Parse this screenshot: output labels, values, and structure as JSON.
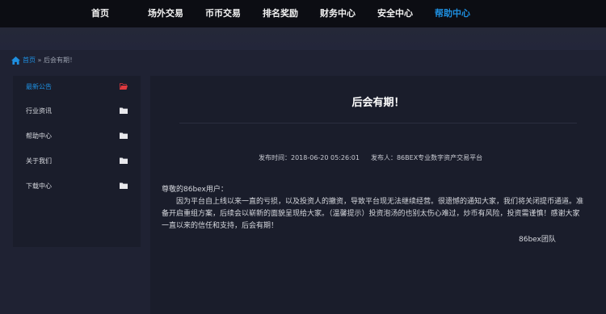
{
  "nav": {
    "items": [
      {
        "label": "首页"
      },
      {
        "label": "场外交易"
      },
      {
        "label": "币币交易"
      },
      {
        "label": "排名奖励"
      },
      {
        "label": "财务中心"
      },
      {
        "label": "安全中心"
      },
      {
        "label": "帮助中心"
      }
    ],
    "active": "帮助中心"
  },
  "breadcrumb": {
    "home": "首页",
    "separator": "»",
    "current": "后会有期！"
  },
  "sidebar": {
    "items": [
      {
        "label": "最新公告",
        "icon": "folder-open-icon"
      },
      {
        "label": "行业资讯",
        "icon": "folder-icon"
      },
      {
        "label": "帮助中心",
        "icon": "folder-icon"
      },
      {
        "label": "关于我们",
        "icon": "folder-icon"
      },
      {
        "label": "下载中心",
        "icon": "folder-icon"
      }
    ],
    "active": "最新公告"
  },
  "article": {
    "title": "后会有期！",
    "publish_time": "发布时间：2018-06-20 05:26:01",
    "publisher": "发布人：86BEX专业数字资产交易平台",
    "greeting": "尊敬的86bex用户：",
    "body": "因为平台自上线以来一直的亏损，以及投资人的撤资，导致平台现无法继续经营。很遗憾的通知大家，我们将关闭提币通道。准备开启重组方案，后续会以崭新的面貌呈现给大家。（温馨提示）投资泡汤的也别太伤心难过，炒币有风险，投资需谨慎！感谢大家一直以来的信任和支持，后会有期！",
    "signature": "86bex团队"
  },
  "colors": {
    "accent": "#1e8fe0",
    "active_folder": "#e0393e",
    "nav_bg": "#0c0d13",
    "panel_bg": "#1a1d2b",
    "page_bg": "#1f2233"
  }
}
